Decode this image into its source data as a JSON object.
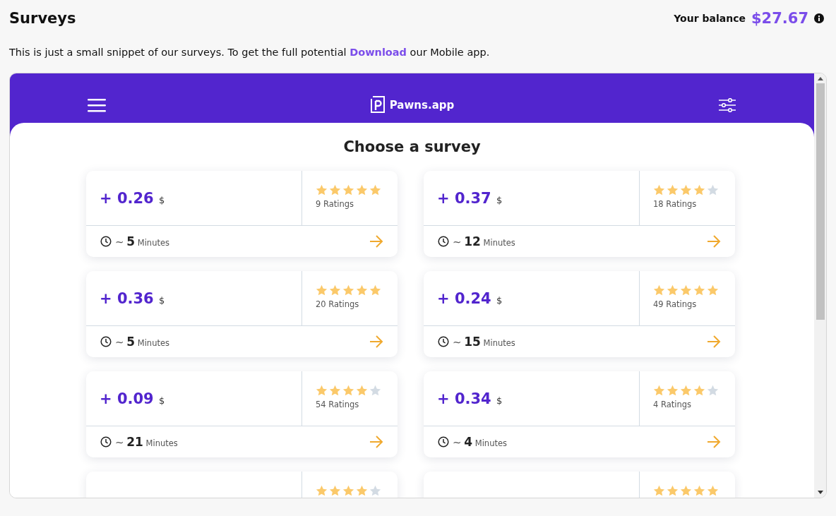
{
  "page": {
    "title": "Surveys",
    "balance_label": "Your balance",
    "balance": "$27.67",
    "intro": "This is just a small snippet of our surveys. To get the full potential **Download** our Mobile app."
  },
  "app": {
    "brand": "Pawns.app",
    "heading": "Choose a survey"
  },
  "surveys": [
    {
      "sign": "+",
      "amount": "0.26",
      "currency": "$",
      "stars": 5,
      "ratings": "9 Ratings",
      "approx": "~",
      "duration": "5",
      "unit": "Minutes"
    },
    {
      "sign": "+",
      "amount": "0.37",
      "currency": "$",
      "stars": 4,
      "ratings": "18 Ratings",
      "approx": "~",
      "duration": "12",
      "unit": "Minutes"
    },
    {
      "sign": "+",
      "amount": "0.36",
      "currency": "$",
      "stars": 5,
      "ratings": "20 Ratings",
      "approx": "~",
      "duration": "5",
      "unit": "Minutes"
    },
    {
      "sign": "+",
      "amount": "0.24",
      "currency": "$",
      "stars": 5,
      "ratings": "49 Ratings",
      "approx": "~",
      "duration": "15",
      "unit": "Minutes"
    },
    {
      "sign": "+",
      "amount": "0.09",
      "currency": "$",
      "stars": 4,
      "ratings": "54 Ratings",
      "approx": "~",
      "duration": "21",
      "unit": "Minutes"
    },
    {
      "sign": "+",
      "amount": "0.34",
      "currency": "$",
      "stars": 4,
      "ratings": "4 Ratings",
      "approx": "~",
      "duration": "4",
      "unit": "Minutes"
    },
    {
      "stars": 4
    },
    {
      "stars": 5
    }
  ]
}
